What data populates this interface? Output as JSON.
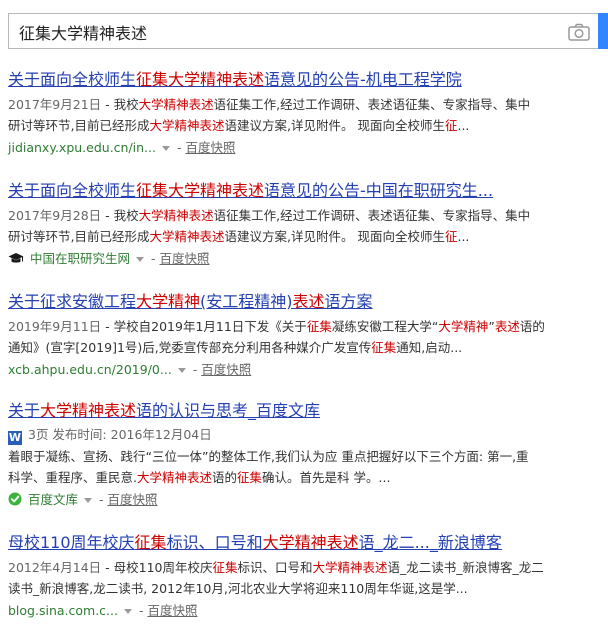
{
  "search": {
    "query": "征集大学精神表述"
  },
  "results": [
    {
      "title": [
        {
          "t": "关于面向全校师生"
        },
        {
          "t": "征集大学精神表述",
          "hl": true
        },
        {
          "t": "语意见的公告-机电工程学院"
        }
      ],
      "date": "2017年9月21日",
      "lines": [
        [
          {
            "t": " - 我校"
          },
          {
            "t": "大学精神表述",
            "hl": true
          },
          {
            "t": "语征集工作,经过工作调研、表述语征集、专家指导、集中"
          }
        ],
        [
          {
            "t": "研讨等环节,目前已经形成"
          },
          {
            "t": "大学精神表述",
            "hl": true
          },
          {
            "t": "语建议方案,详见附件。 现面向全校师生"
          },
          {
            "t": "征",
            "hl": true
          },
          {
            "t": "..."
          }
        ]
      ],
      "url": "jidianxy.xpu.edu.cn/in...",
      "snapshot": "百度快照"
    },
    {
      "title": [
        {
          "t": "关于面向全校师生"
        },
        {
          "t": "征集大学精神表述",
          "hl": true
        },
        {
          "t": "语意见的公告-中国在职研究生..."
        }
      ],
      "date": "2017年9月28日",
      "lines": [
        [
          {
            "t": " - 我校"
          },
          {
            "t": "大学精神表述",
            "hl": true
          },
          {
            "t": "语征集工作,经过工作调研、表述语征集、专家指导、集中"
          }
        ],
        [
          {
            "t": "研讨等环节,目前已经形成"
          },
          {
            "t": "大学精神表述",
            "hl": true
          },
          {
            "t": "语建议方案,详见附件。 现面向全校师生"
          },
          {
            "t": "征",
            "hl": true
          },
          {
            "t": "..."
          }
        ]
      ],
      "url": "中国在职研究生网",
      "snapshot": "百度快照"
    },
    {
      "title": [
        {
          "t": "关于征求安徽工程"
        },
        {
          "t": "大学精神",
          "hl": true
        },
        {
          "t": "(安工程精神)"
        },
        {
          "t": "表述",
          "hl": true
        },
        {
          "t": "语方案"
        }
      ],
      "date": "2019年9月11日",
      "lines": [
        [
          {
            "t": " - 学校自2019年1月11日下发《关于"
          },
          {
            "t": "征集",
            "hl": true
          },
          {
            "t": "凝练安徽工程大学“"
          },
          {
            "t": "大学精神",
            "hl": true
          },
          {
            "t": "”"
          },
          {
            "t": "表述",
            "hl": true
          },
          {
            "t": "语的"
          }
        ],
        [
          {
            "t": "通知》(宣字[2019]1号)后,党委宣传部充分利用各种媒介广发宣传"
          },
          {
            "t": "征集",
            "hl": true
          },
          {
            "t": "通知,启动..."
          }
        ]
      ],
      "url": "xcb.ahpu.edu.cn/2019/0...",
      "snapshot": "百度快照"
    },
    {
      "title": [
        {
          "t": "关于"
        },
        {
          "t": "大学精神表述",
          "hl": true
        },
        {
          "t": "语的认识与思考_百度文库"
        }
      ],
      "doc_meta": "3页 发布时间: 2016年12月04日",
      "lines": [
        [
          {
            "t": "着眼于凝练、宣扬、践行“三位一体”的整体工作,我们认为应 重点把握好以下三个方面: 第一,重"
          }
        ],
        [
          {
            "t": "科学、重程序、重民意."
          },
          {
            "t": "大学精神表述",
            "hl": true
          },
          {
            "t": "语的"
          },
          {
            "t": "征集",
            "hl": true
          },
          {
            "t": "确认。首先是科 学。..."
          }
        ]
      ],
      "url": "百度文库",
      "snapshot": "百度快照"
    },
    {
      "title": [
        {
          "t": "母校110周年校庆"
        },
        {
          "t": "征集",
          "hl": true
        },
        {
          "t": "标识、口号和"
        },
        {
          "t": "大学精神表述",
          "hl": true
        },
        {
          "t": "语_龙二..._新浪博客"
        }
      ],
      "date": "2012年4月14日",
      "lines": [
        [
          {
            "t": " - 母校110周年校庆"
          },
          {
            "t": "征集",
            "hl": true
          },
          {
            "t": "标识、口号和"
          },
          {
            "t": "大学精神表述",
            "hl": true
          },
          {
            "t": "语_龙二读书_新浪博客_龙二"
          }
        ],
        [
          {
            "t": "读书_新浪博客,龙二读书, 2012年10月,河北农业大学将迎来110周年华诞,这是学..."
          }
        ]
      ],
      "url": "blog.sina.com.c...",
      "snapshot": "百度快照"
    }
  ],
  "colors": {
    "title_link": "#2440b3",
    "highlight": "#cc0000",
    "url_green": "#2e7d32",
    "search_accent": "#3385ff"
  },
  "icons": {
    "camera": "camera-icon",
    "graduation_cap": "graduation-cap-icon",
    "word_doc": "word-doc-icon",
    "wenku_logo": "wenku-logo-icon"
  }
}
